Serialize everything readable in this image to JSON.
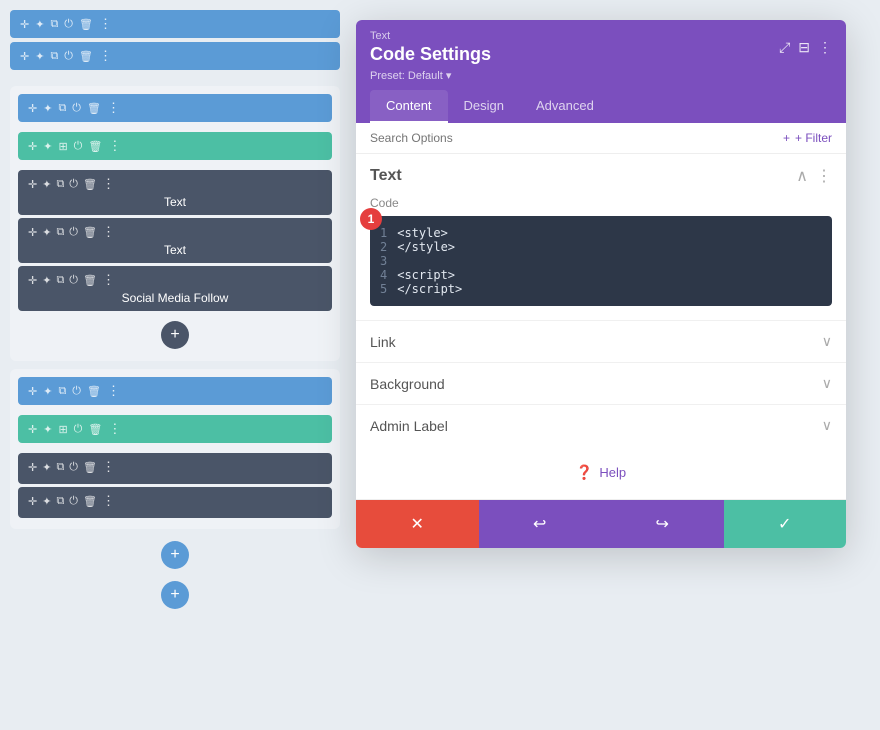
{
  "builder": {
    "rows": [
      {
        "type": "row-top",
        "color": "blue",
        "icons": [
          "✛",
          "✦",
          "⧉",
          "⏻",
          "🗑",
          "⋮"
        ]
      },
      {
        "type": "row-top",
        "color": "blue",
        "icons": [
          "✛",
          "✦",
          "⧉",
          "⏻",
          "🗑",
          "⋮"
        ]
      }
    ],
    "sections": [
      {
        "rowColor": "blue",
        "rowIcons": [
          "✛",
          "✦",
          "⧉",
          "⏻",
          "🗑",
          "⋮"
        ],
        "columnColor": "teal",
        "columnIcons": [
          "✛",
          "✦",
          "⊞",
          "⏻",
          "🗑",
          "⋮"
        ],
        "modules": [
          {
            "icons": [
              "✛",
              "✦",
              "⧉",
              "⏻",
              "🗑",
              "⋮"
            ],
            "label": "Text"
          },
          {
            "icons": [
              "✛",
              "✦",
              "⧉",
              "⏻",
              "🗑",
              "⋮"
            ],
            "label": "Text"
          },
          {
            "icons": [
              "✛",
              "✦",
              "⧉",
              "⏻",
              "🗑",
              "⋮"
            ],
            "label": "Social Media Follow"
          }
        ]
      },
      {
        "rowColor": "blue",
        "rowIcons": [
          "✛",
          "✦",
          "⧉",
          "⏻",
          "🗑",
          "⋮"
        ],
        "columnColor": "teal",
        "columnIcons": [
          "✛",
          "✦",
          "⊞",
          "⏻",
          "🗑",
          "⋮"
        ],
        "modules": [
          {
            "icons": [
              "✛",
              "✦",
              "⧉",
              "⏻",
              "🗑",
              "⋮"
            ],
            "label": ""
          },
          {
            "icons": [
              "✛",
              "✦",
              "⧉",
              "⏻",
              "🗑",
              "⋮"
            ],
            "label": ""
          }
        ]
      }
    ]
  },
  "settings": {
    "window_label": "Text",
    "title": "Code Settings",
    "preset": "Preset: Default ▾",
    "tabs": [
      "Content",
      "Design",
      "Advanced"
    ],
    "active_tab": "Content",
    "search_placeholder": "Search Options",
    "filter_label": "+ Filter",
    "section": {
      "title": "Text",
      "code_label": "Code",
      "code_lines": [
        {
          "num": "1",
          "code": "<style>"
        },
        {
          "num": "2",
          "code": "</style>"
        },
        {
          "num": "3",
          "code": ""
        },
        {
          "num": "4",
          "code": "<script>"
        },
        {
          "num": "5",
          "code": "</script>"
        }
      ]
    },
    "collapsibles": [
      {
        "label": "Link"
      },
      {
        "label": "Background"
      },
      {
        "label": "Admin Label"
      }
    ],
    "help_label": "Help",
    "actions": {
      "cancel": "✕",
      "undo": "↩",
      "redo": "↪",
      "save": "✓"
    }
  }
}
